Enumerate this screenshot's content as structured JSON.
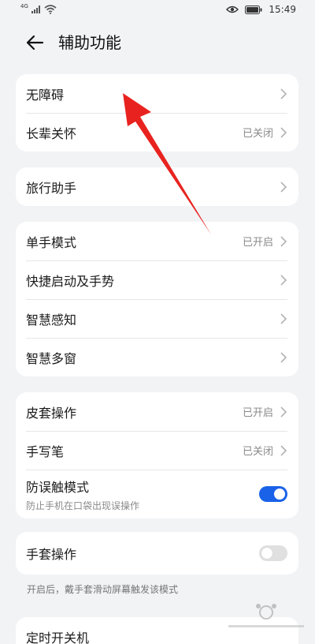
{
  "status": {
    "net": "4G",
    "time": "15:49"
  },
  "header": {
    "title": "辅助功能"
  },
  "groups": [
    {
      "rows": [
        {
          "label": "无障碍",
          "value": ""
        },
        {
          "label": "长辈关怀",
          "value": "已关闭"
        }
      ]
    },
    {
      "rows": [
        {
          "label": "旅行助手",
          "value": ""
        }
      ]
    },
    {
      "rows": [
        {
          "label": "单手模式",
          "value": "已开启"
        },
        {
          "label": "快捷启动及手势",
          "value": ""
        },
        {
          "label": "智慧感知",
          "value": ""
        },
        {
          "label": "智慧多窗",
          "value": ""
        }
      ]
    },
    {
      "rows": [
        {
          "label": "皮套操作",
          "value": "已开启"
        },
        {
          "label": "手写笔",
          "value": "已关闭"
        },
        {
          "label": "防误触模式",
          "sub": "防止手机在口袋出现误操作",
          "toggle": "on"
        }
      ]
    },
    {
      "rows": [
        {
          "label": "手套操作",
          "toggle": "off"
        }
      ]
    },
    {
      "rows": [
        {
          "label": "定时开关机"
        }
      ]
    }
  ],
  "glove_note": "开启后，戴手套滑动屏幕触发该模式",
  "colors": {
    "accent": "#1a62e8",
    "annotation_arrow": "#e8231f"
  },
  "icons": {
    "back": "arrow-left-icon",
    "chevron": "chevron-right-icon",
    "eye": "eye-icon",
    "battery": "battery-icon",
    "wifi": "wifi-icon",
    "signal": "signal-icon"
  }
}
